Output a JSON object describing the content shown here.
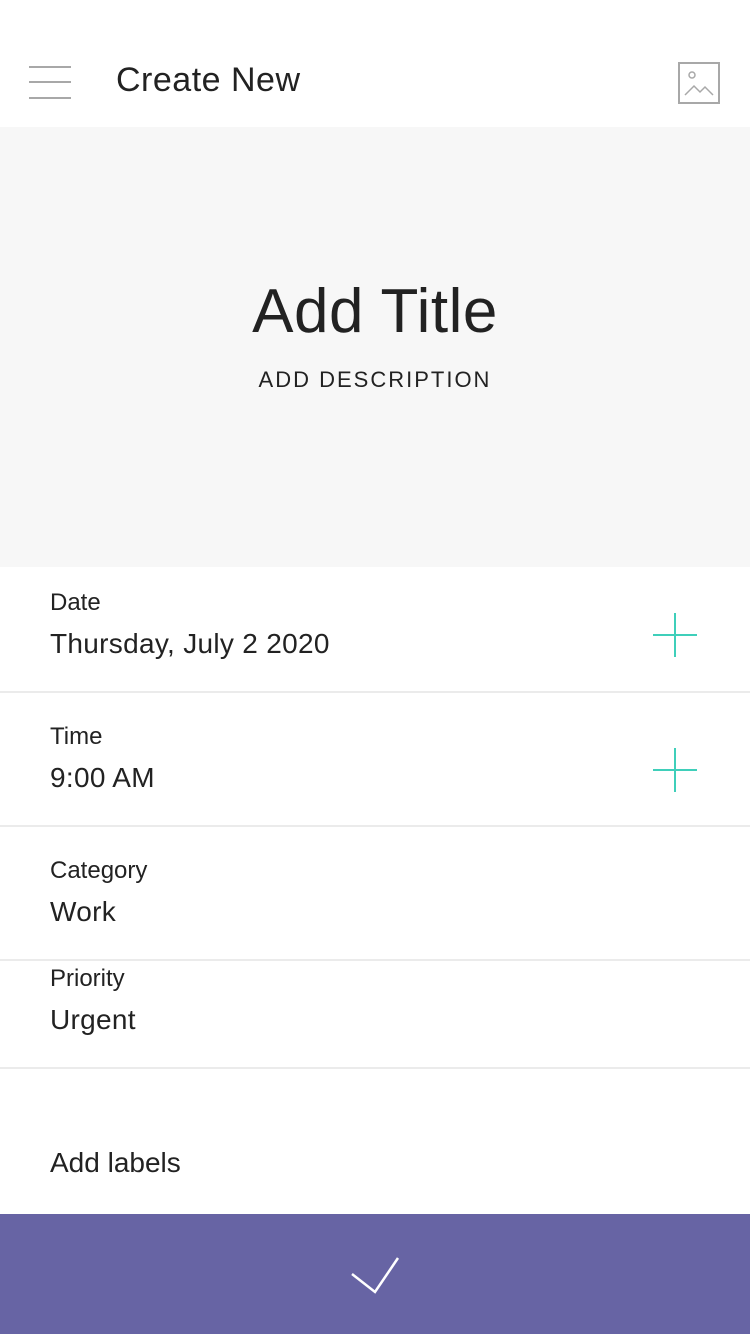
{
  "header": {
    "title": "Create New",
    "menu_icon": "hamburger-menu-icon",
    "image_icon": "image-placeholder-icon"
  },
  "hero": {
    "title": "Add Title",
    "description": "ADD DESCRIPTION"
  },
  "fields": {
    "date": {
      "label": "Date",
      "value": "Thursday, July 2 2020"
    },
    "time": {
      "label": "Time",
      "value": "9:00 AM"
    },
    "category": {
      "label": "Category",
      "value": "Work"
    },
    "priority": {
      "label": "Priority",
      "value": "Urgent"
    }
  },
  "labels": {
    "add_label": "Add labels"
  },
  "submit": {
    "icon": "checkmark-icon"
  },
  "colors": {
    "accent": "#3fcfba",
    "submit_bar": "#6764a4",
    "hero_background": "#f7f7f7",
    "divider": "#ebebeb"
  }
}
